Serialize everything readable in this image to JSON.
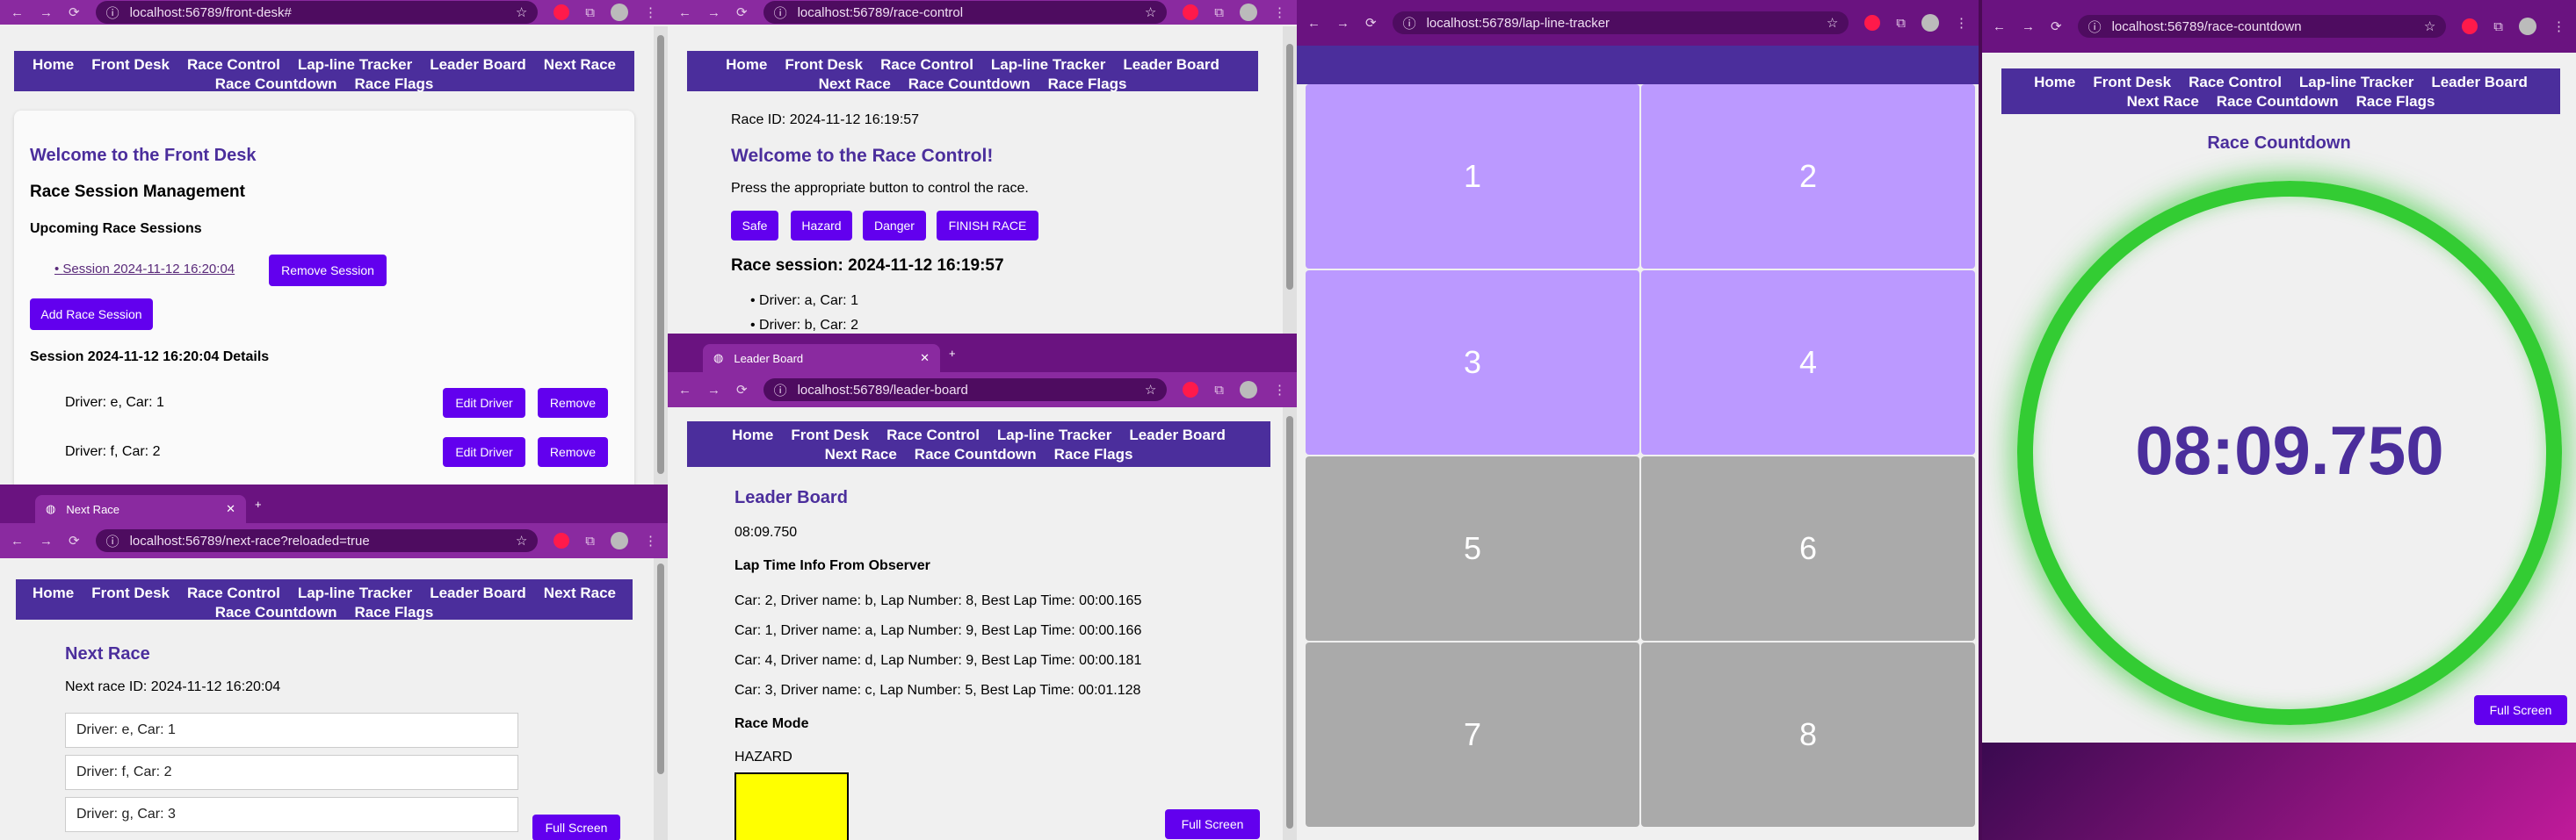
{
  "nav": [
    "Home",
    "Front Desk",
    "Race Control",
    "Lap-line Tracker",
    "Leader Board",
    "Next Race",
    "Race Countdown",
    "Race Flags"
  ],
  "icons": {
    "back": "back-arrow-icon",
    "forward": "forward-arrow-icon",
    "reload": "reload-icon",
    "info": "site-info-icon",
    "star": "bookmark-star-icon",
    "ext": "extension-icon",
    "puzzle": "extensions-puzzle-icon",
    "profile": "profile-avatar-icon",
    "menu": "kebab-menu-icon"
  },
  "front_desk": {
    "url": "localhost:56789/front-desk#",
    "welcome": "Welcome to the Front Desk",
    "mgmt": "Race Session Management",
    "upcoming": "Upcoming Race Sessions",
    "session_link": "Session 2024-11-12 16:20:04",
    "remove_session": "Remove Session",
    "add_session": "Add Race Session",
    "details": "Session 2024-11-12 16:20:04 Details",
    "drivers": [
      "Driver: e, Car: 1",
      "Driver: f, Car: 2"
    ],
    "edit": "Edit Driver",
    "remove": "Remove"
  },
  "race_control": {
    "url": "localhost:56789/race-control",
    "race_id": "Race ID: 2024-11-12 16:19:57",
    "welcome": "Welcome to the Race Control!",
    "instruct": "Press the appropriate button to control the race.",
    "buttons": [
      "Safe",
      "Hazard",
      "Danger",
      "FINISH RACE"
    ],
    "session": "Race session: 2024-11-12 16:19:57",
    "drivers": [
      "Driver: a, Car: 1",
      "Driver: b, Car: 2"
    ]
  },
  "lap_tracker": {
    "url": "localhost:56789/lap-line-tracker",
    "tiles": [
      "1",
      "2",
      "3",
      "4",
      "5",
      "6",
      "7",
      "8"
    ],
    "active_color": "#bb99ff",
    "inactive_color": "#aaaaaa"
  },
  "countdown": {
    "url": "localhost:56789/race-countdown",
    "title": "Race Countdown",
    "time": "08:09.750",
    "full": "Full Screen",
    "ring_color": "#33cc33"
  },
  "next_race": {
    "tab": "Next Race",
    "url": "localhost:56789/next-race?reloaded=true",
    "title": "Next Race",
    "race_id": "Next race ID: 2024-11-12 16:20:04",
    "drivers": [
      "Driver: e, Car: 1",
      "Driver: f, Car: 2",
      "Driver: g, Car: 3"
    ],
    "full": "Full Screen"
  },
  "leader": {
    "tab": "Leader Board",
    "url": "localhost:56789/leader-board",
    "title": "Leader Board",
    "time": "08:09.750",
    "lap_head": "Lap Time Info From Observer",
    "laps": [
      "Car: 2, Driver name: b, Lap Number: 8, Best Lap Time: 00:00.165",
      "Car: 1, Driver name: a, Lap Number: 9, Best Lap Time: 00:00.166",
      "Car: 4, Driver name: d, Lap Number: 9, Best Lap Time: 00:00.181",
      "Car: 3, Driver name: c, Lap Number: 5, Best Lap Time: 00:01.128"
    ],
    "mode_head": "Race Mode",
    "mode": "HAZARD",
    "flag_color": "#ffff00",
    "full": "Full Screen"
  }
}
